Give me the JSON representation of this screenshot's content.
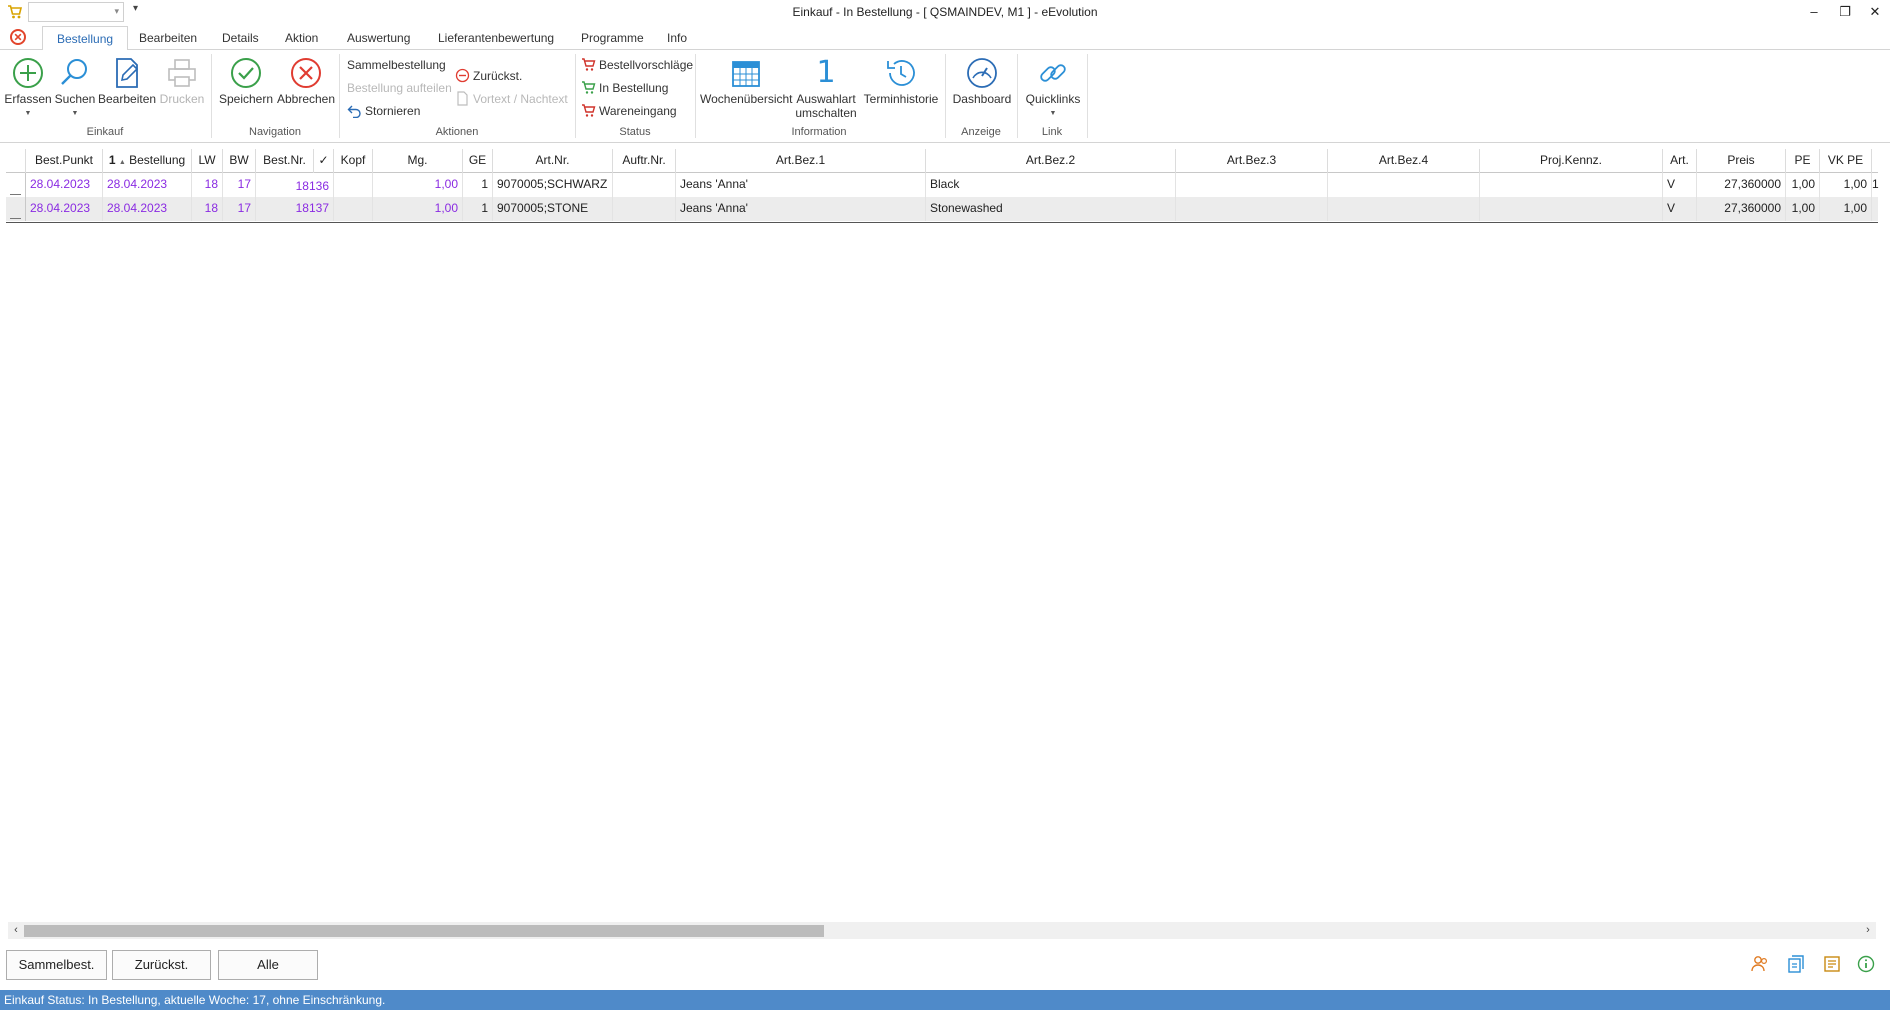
{
  "window": {
    "title": "Einkauf - In Bestellung - [ QSMAINDEV, M1 ]  -  eEvolution",
    "quick_access_value": "",
    "minimize": "–",
    "maximize": "❐",
    "close": "✕",
    "qa_menu": "▾"
  },
  "tabs": [
    {
      "label": "Bestellung",
      "active": true
    },
    {
      "label": "Bearbeiten"
    },
    {
      "label": "Details"
    },
    {
      "label": "Aktion"
    },
    {
      "label": "Auswertung"
    },
    {
      "label": "Lieferantenbewertung"
    },
    {
      "label": "Programme"
    },
    {
      "label": "Info"
    }
  ],
  "ribbon": {
    "einkauf": {
      "label": "Einkauf",
      "erfassen": "Erfassen",
      "suchen": "Suchen",
      "bearbeiten": "Bearbeiten",
      "drucken": "Drucken"
    },
    "navigation": {
      "label": "Navigation",
      "speichern": "Speichern",
      "abbrechen": "Abbrechen"
    },
    "aktionen": {
      "label": "Aktionen",
      "sammelbestellung": "Sammelbestellung",
      "bestellung_aufteilen": "Bestellung aufteilen",
      "stornieren": "Stornieren",
      "zurueckst": "Zurückst.",
      "vortext": "Vortext / Nachtext"
    },
    "status": {
      "label": "Status",
      "bestellvorschlaege": "Bestellvorschläge",
      "in_bestellung": "In Bestellung",
      "wareneingang": "Wareneingang"
    },
    "information": {
      "label": "Information",
      "wochenuebersicht": "Wochenübersicht",
      "auswahlart_1": "Auswahlart",
      "auswahlart_2": "umschalten",
      "auswahlart_icon": "1",
      "terminhistorie": "Terminhistorie"
    },
    "anzeige": {
      "label": "Anzeige",
      "dashboard": "Dashboard"
    },
    "link": {
      "label": "Link",
      "quicklinks": "Quicklinks"
    }
  },
  "grid": {
    "columns": [
      "Best.Punkt",
      "Bestellung",
      "LW",
      "BW",
      "Best.Nr.",
      "✓",
      "Kopf",
      "Mg.",
      "GE",
      "Art.Nr.",
      "Auftr.Nr.",
      "Art.Bez.1",
      "Art.Bez.2",
      "Art.Bez.3",
      "Art.Bez.4",
      "Proj.Kennz.",
      "Art.",
      "Preis",
      "PE",
      "VK PE"
    ],
    "sort_marker": "1",
    "rows": [
      {
        "best_punkt": "28.04.2023",
        "bestellung": "28.04.2023",
        "lw": "18",
        "bw": "17",
        "best_nr": "18136",
        "kopf": "",
        "mg": "1,00",
        "ge": "1",
        "art_nr": "9070005;SCHWARZ",
        "auftr_nr": "",
        "art_bez1": "Jeans 'Anna'",
        "art_bez2": "Black",
        "art_bez3": "",
        "art_bez4": "",
        "proj": "",
        "art": "V",
        "preis": "27,360000",
        "pe": "1,00",
        "vk_pe": "1,00",
        "extra": "1"
      },
      {
        "best_punkt": "28.04.2023",
        "bestellung": "28.04.2023",
        "lw": "18",
        "bw": "17",
        "best_nr": "18137",
        "kopf": "",
        "mg": "1,00",
        "ge": "1",
        "art_nr": "9070005;STONE",
        "auftr_nr": "",
        "art_bez1": "Jeans 'Anna'",
        "art_bez2": "Stonewashed",
        "art_bez3": "",
        "art_bez4": "",
        "proj": "",
        "art": "V",
        "preis": "27,360000",
        "pe": "1,00",
        "vk_pe": "1,00",
        "extra": ""
      }
    ]
  },
  "scroll": {
    "left": "‹",
    "right": "›"
  },
  "footer": {
    "sammelbest": "Sammelbest.",
    "zurueckst": "Zurückst.",
    "alle": "Alle"
  },
  "statusbar": {
    "text": "Einkauf Status: In Bestellung, aktuelle Woche: 17, ohne Einschränkung."
  },
  "colors": {
    "accent": "#2b6cb5",
    "status_bar": "#4f8ac9",
    "grid_link_text": "#8a2be2",
    "cancel_red": "#e03c31",
    "ok_green": "#3aa04a"
  }
}
